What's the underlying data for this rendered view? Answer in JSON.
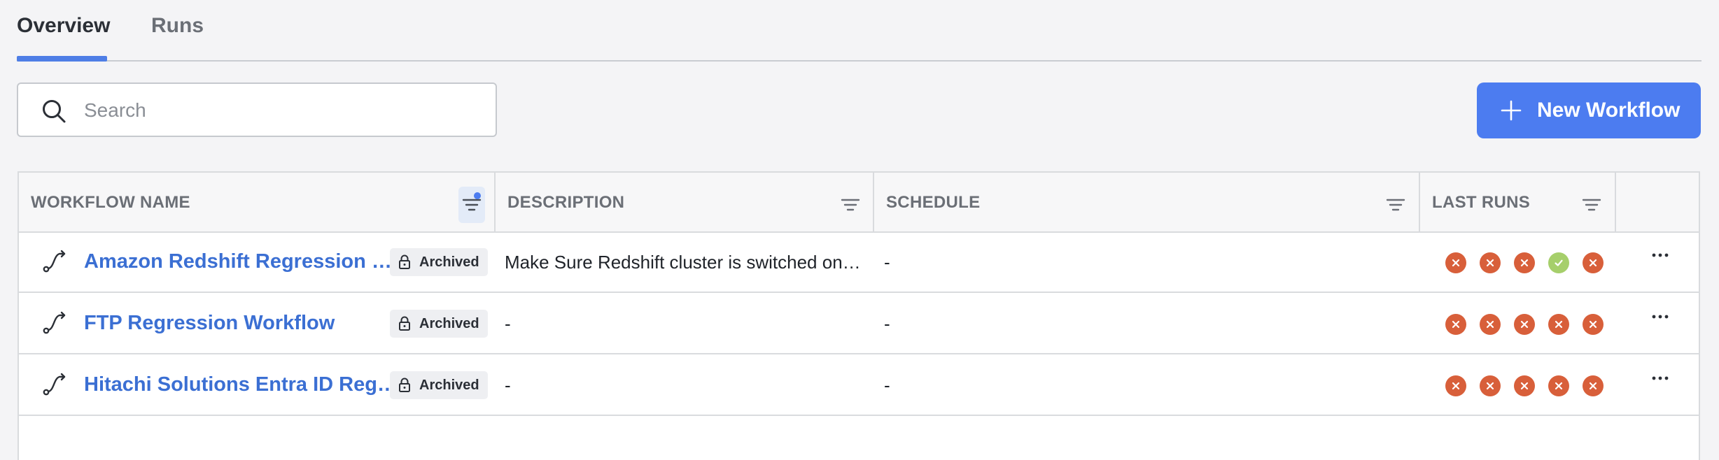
{
  "tabs": [
    {
      "label": "Overview",
      "active": true
    },
    {
      "label": "Runs",
      "active": false
    }
  ],
  "search": {
    "placeholder": "Search",
    "value": "",
    "icon": "search-icon"
  },
  "new_workflow_button": {
    "label": "New Workflow",
    "icon": "plus-icon"
  },
  "table": {
    "columns": [
      {
        "label": "WORKFLOW NAME",
        "filter_active": true
      },
      {
        "label": "DESCRIPTION",
        "filter_active": false
      },
      {
        "label": "SCHEDULE",
        "filter_active": false
      },
      {
        "label": "LAST RUNS",
        "filter_active": false
      },
      {
        "label": ""
      }
    ],
    "rows": [
      {
        "name": "Amazon Redshift Regression …",
        "badge": "Archived",
        "description": "Make Sure Redshift cluster is switched on…",
        "schedule": "-",
        "last_runs": [
          "failed",
          "failed",
          "failed",
          "success",
          "failed"
        ]
      },
      {
        "name": "FTP Regression Workflow",
        "badge": "Archived",
        "description": "-",
        "schedule": "-",
        "last_runs": [
          "failed",
          "failed",
          "failed",
          "failed",
          "failed"
        ]
      },
      {
        "name": "Hitachi Solutions Entra ID Reg…",
        "badge": "Archived",
        "description": "-",
        "schedule": "-",
        "last_runs": [
          "failed",
          "failed",
          "failed",
          "failed",
          "failed"
        ]
      }
    ]
  },
  "colors": {
    "accent": "#4c7cf0",
    "link": "#3b6fd3",
    "run_failed": "#d85f3a",
    "run_success": "#a6cf6b"
  }
}
